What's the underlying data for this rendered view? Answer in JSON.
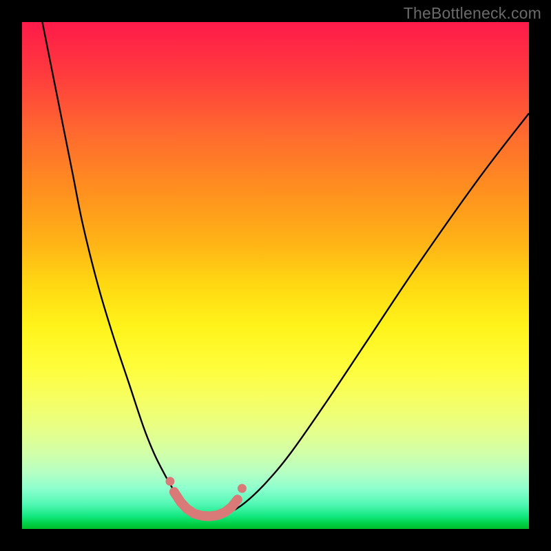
{
  "watermark": {
    "text": "TheBottleneck.com"
  },
  "colors": {
    "page_bg": "#000000",
    "curve_stroke": "#000000",
    "marker_fill": "#d97a78",
    "marker_stroke": "#d97a78",
    "gradient_top": "#ff1a4a",
    "gradient_mid": "#ffe21a",
    "gradient_bottom": "#00bb2a"
  },
  "chart_data": {
    "type": "line",
    "title": "",
    "xlabel": "",
    "ylabel": "",
    "xlim": [
      0,
      100
    ],
    "ylim": [
      0,
      100
    ],
    "series": [
      {
        "name": "bottleneck_curve",
        "x": [
          4,
          6,
          8,
          10,
          12,
          15,
          18,
          21,
          24,
          26,
          28,
          30,
          31,
          32,
          33,
          34,
          35,
          37,
          39,
          41,
          44,
          48,
          53,
          60,
          68,
          78,
          90,
          100
        ],
        "y": [
          100,
          90,
          80,
          70,
          60,
          48,
          38,
          29,
          20,
          15,
          11,
          7.5,
          6,
          4.7,
          3.7,
          3,
          2.6,
          2.5,
          2.7,
          3.3,
          5.2,
          9,
          15,
          25,
          37,
          52,
          69,
          82
        ]
      }
    ],
    "markers": {
      "name": "data_markers",
      "x": [
        30,
        31.3,
        32.5,
        34,
        35.5,
        37,
        38.5,
        40,
        41.3,
        42.5
      ],
      "y": [
        7.3,
        5.3,
        4,
        3,
        2.6,
        2.5,
        2.7,
        3.3,
        4.3,
        5.8
      ]
    },
    "annotations": []
  }
}
